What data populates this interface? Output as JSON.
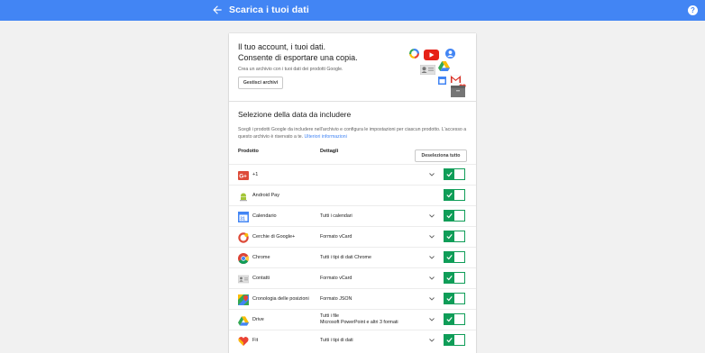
{
  "header": {
    "title": "Scarica i tuoi dati",
    "help_glyph": "?"
  },
  "hero": {
    "title_line1": "Il tuo account, i tuoi dati.",
    "title_line2": "Consente di esportare una copia.",
    "subtitle": "Crea un archivio con i tuoi dati dei prodotti Google.",
    "manage_button": "Gestisci archivi"
  },
  "selection": {
    "title": "Selezione della data da includere",
    "description": "Scegli i prodotti Google da includere nell'archivio e configura le impostazioni per ciascun prodotto. L'accesso a questo archivio è riservato a te.",
    "learn_more": "Ulteriori informazioni",
    "col_product": "Prodotto",
    "col_details": "Dettagli",
    "deselect_all": "Deseleziona tutto"
  },
  "products": [
    {
      "name": "+1",
      "details": "",
      "details2": "",
      "expandable": true,
      "selected": true,
      "icon": "google-plus-one-icon"
    },
    {
      "name": "Android Pay",
      "details": "",
      "details2": "",
      "expandable": false,
      "selected": true,
      "icon": "android-pay-icon"
    },
    {
      "name": "Calendario",
      "details": "Tutti i calendari",
      "details2": "",
      "expandable": true,
      "selected": true,
      "icon": "calendar-icon"
    },
    {
      "name": "Cerchie di Google+",
      "details": "Formato vCard",
      "details2": "",
      "expandable": true,
      "selected": true,
      "icon": "google-plus-circles-icon"
    },
    {
      "name": "Chrome",
      "details": "Tutti i tipi di dati Chrome",
      "details2": "",
      "expandable": true,
      "selected": true,
      "icon": "chrome-icon"
    },
    {
      "name": "Contatti",
      "details": "Formato vCard",
      "details2": "",
      "expandable": true,
      "selected": true,
      "icon": "contacts-icon"
    },
    {
      "name": "Cronologia delle posizioni",
      "details": "Formato JSON",
      "details2": "",
      "expandable": true,
      "selected": true,
      "icon": "maps-location-history-icon"
    },
    {
      "name": "Drive",
      "details": "Tutti i file",
      "details2": "Microsoft PowerPoint e altri 3 formati",
      "expandable": true,
      "selected": true,
      "icon": "drive-icon"
    },
    {
      "name": "Fit",
      "details": "Tutti i tipi di dati",
      "details2": "",
      "expandable": true,
      "selected": true,
      "icon": "fit-icon"
    }
  ],
  "colors": {
    "header_bg": "#4285f4",
    "toggle_on": "#0f9d58",
    "link": "#4285f4"
  }
}
